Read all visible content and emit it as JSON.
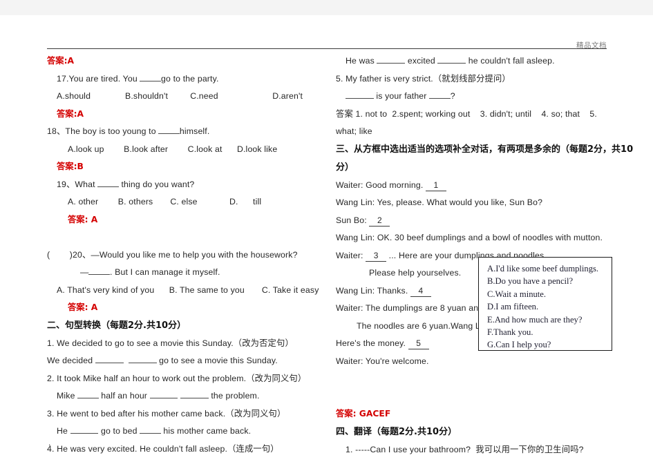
{
  "page": {
    "header_watermark": "精品文档",
    "trailing_dot": "."
  },
  "left_column": {
    "blocks": [
      {
        "kind": "answer",
        "text": "答案:A"
      },
      {
        "kind": "question",
        "indent": 1,
        "text": "17.You are tired. You ______go to the party."
      },
      {
        "kind": "choices",
        "indent": 1,
        "text": "A.should              B.shouldn't         C.need                      D.aren't"
      },
      {
        "kind": "answer",
        "indent": 1,
        "text": "答案:A"
      },
      {
        "kind": "question",
        "indent": 0,
        "text": "18、The boy is too young to ______himself."
      },
      {
        "kind": "choices",
        "indent": 2,
        "text": "A.look up        B.look after        C.look at      D.look like"
      },
      {
        "kind": "answer",
        "indent": 1,
        "text": "答案:B"
      },
      {
        "kind": "question",
        "indent": 1,
        "text": "19、What ______ thing do you want?"
      },
      {
        "kind": "choices",
        "indent": 2,
        "text": "A. other        B. others       C. else             D.      till"
      },
      {
        "kind": "answer",
        "indent": 2,
        "text": "答案: A"
      },
      {
        "kind": "spacer"
      },
      {
        "kind": "question",
        "indent": 0,
        "text": "(        )20、—Would you like me to help you with the housework?"
      },
      {
        "kind": "question",
        "indent": 3,
        "text": "—______. But I can manage it myself."
      },
      {
        "kind": "choices",
        "indent": 1,
        "text": "A. That's very kind of you      B. The same to you       C. Take it easy"
      },
      {
        "kind": "answer",
        "indent": 2,
        "text": "答案: A"
      },
      {
        "kind": "section",
        "indent": 0,
        "text": "二、句型转换（每题2分.共10分）"
      },
      {
        "kind": "question",
        "indent": 0,
        "text": "1. We decided to go to see a movie this Sunday.（改为否定句）"
      },
      {
        "kind": "question",
        "indent": 0,
        "text": "We decided ________  ________ go to see a movie this Sunday."
      },
      {
        "kind": "question",
        "indent": 0,
        "text": "2. It took Mike half an hour to work out the problem.（改为同义句）"
      },
      {
        "kind": "question",
        "indent": 1,
        "text": "Mike ______ half an hour ________ ________ the problem."
      },
      {
        "kind": "question",
        "indent": 0,
        "text": "3. He went to bed after his mother came back.（改为同义句）"
      },
      {
        "kind": "question",
        "indent": 1,
        "text": "He ________ go to bed ______ his mother came back."
      },
      {
        "kind": "question",
        "indent": 0,
        "text": "4. He was very excited. He couldn't fall asleep.（连成一句）"
      }
    ]
  },
  "right_column": {
    "blocks": [
      {
        "kind": "question",
        "indent": 1,
        "text": "He was ________ excited ________ he couldn't fall asleep."
      },
      {
        "kind": "question",
        "indent": 0,
        "text": "5. My father is very strict.（就划线部分提问）"
      },
      {
        "kind": "question",
        "indent": 1,
        "text": "________ is your father ______?"
      },
      {
        "kind": "question",
        "indent": 0,
        "text": "答案 1. not to  2.spent; working out    3. didn't; until    4. so; that    5."
      },
      {
        "kind": "question",
        "indent": 0,
        "text": "what; like"
      },
      {
        "kind": "section",
        "indent": 0,
        "text": "三、从方框中选出适当的选项补全对话，有两项是多余的（每题2分，共10"
      },
      {
        "kind": "section",
        "indent": 0,
        "text": "分）"
      },
      {
        "kind": "dialog",
        "indent": 0,
        "text": "Waiter: Good morning. ",
        "blank_num": "1"
      },
      {
        "kind": "dialog",
        "indent": 0,
        "text": "Wang Lin: Yes, please. What would you like, Sun Bo?"
      },
      {
        "kind": "dialog",
        "indent": 0,
        "text": "Sun Bo: ",
        "blank_num": "2"
      },
      {
        "kind": "dialog",
        "indent": 0,
        "text": "Wang Lin: OK. 30 beef dumplings and a bowl of noodles with mutton."
      },
      {
        "kind": "dialog",
        "indent": 0,
        "text": "Waiter: ",
        "blank_num": "3",
        "after": " ... Here are your dumplings and noodles."
      },
      {
        "kind": "dialog",
        "indent": 3,
        "text": "Please help yourselves."
      },
      {
        "kind": "dialog",
        "indent": 0,
        "text": "Wang Lin: Thanks. ",
        "blank_num": "4"
      },
      {
        "kind": "dialog",
        "indent": 0,
        "text": "Waiter: The dumplings are 8 yuan and"
      },
      {
        "kind": "dialog",
        "indent": 2,
        "text": "The noodles are 6 yuan.Wang Lin:"
      },
      {
        "kind": "dialog",
        "indent": 0,
        "text": "Here's the money. ",
        "blank_num": "5"
      },
      {
        "kind": "dialog",
        "indent": 0,
        "text": "Waiter: You're welcome."
      },
      {
        "kind": "spacer"
      },
      {
        "kind": "spacer"
      },
      {
        "kind": "answer",
        "indent": 0,
        "text": "答案: GACEF"
      },
      {
        "kind": "section",
        "indent": 0,
        "text": "四、翻译（每题2分.共10分）"
      },
      {
        "kind": "question",
        "indent": 1,
        "text": "1. -----Can I use your bathroom?  我可以用一下你的卫生间吗?"
      }
    ]
  },
  "options_box": {
    "options": [
      "A.I'd like some beef dumplings.",
      "B.Do you have a pencil?",
      "C.Wait a minute.",
      "D.I am fifteen.",
      "E.And how much are they?",
      "F.Thank you.",
      "G.Can I help you?"
    ]
  },
  "colors": {
    "answer_red": "#d40000",
    "text": "#262626",
    "watermark": "#7a7a7a",
    "page_bg": "#ffffff",
    "outer_bg": "#f4f4f4"
  }
}
